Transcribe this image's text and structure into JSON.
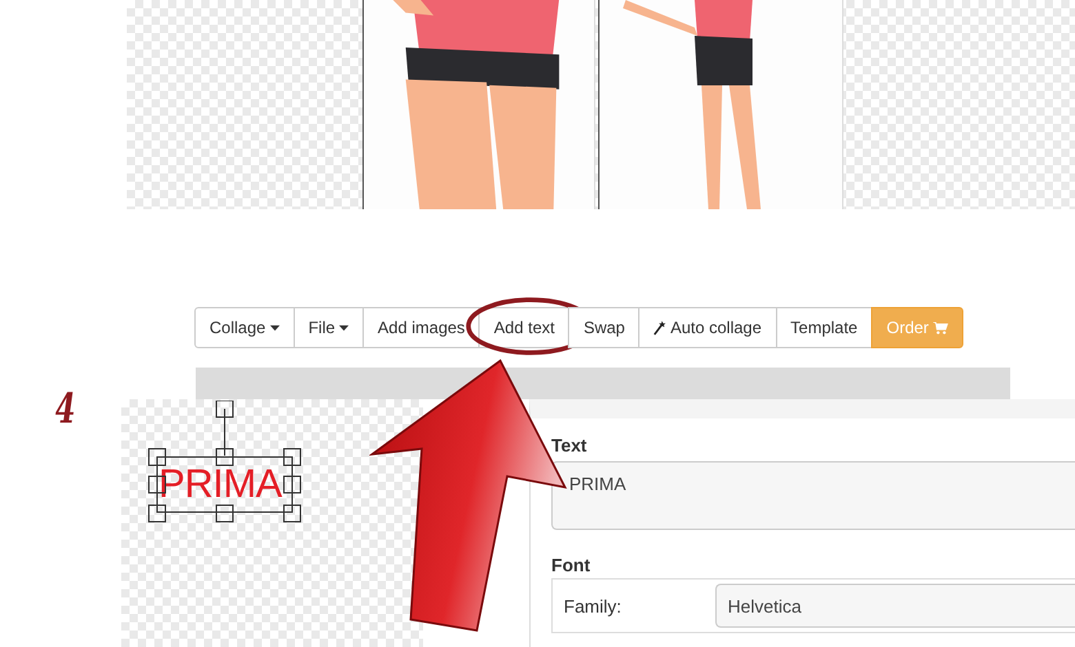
{
  "step_number": "4",
  "toolbar": [
    {
      "label": "Collage",
      "kind": "dropdown",
      "circled": false
    },
    {
      "label": "File",
      "kind": "dropdown",
      "circled": false
    },
    {
      "label": "Add images",
      "kind": "plain",
      "circled": false
    },
    {
      "label": "Add text",
      "kind": "plain",
      "circled": true
    },
    {
      "label": "Swap",
      "kind": "plain",
      "circled": false
    },
    {
      "label": "Auto collage",
      "kind": "wand",
      "circled": false
    },
    {
      "label": "Template",
      "kind": "plain",
      "circled": false
    },
    {
      "label": "Order",
      "kind": "cart",
      "circled": false
    }
  ],
  "canvas_text": "PRIMA",
  "text_panel": {
    "text_label": "Text",
    "text_value": "PRIMA",
    "font_heading": "Font",
    "family_label": "Family:",
    "family_value": "Helvetica"
  }
}
